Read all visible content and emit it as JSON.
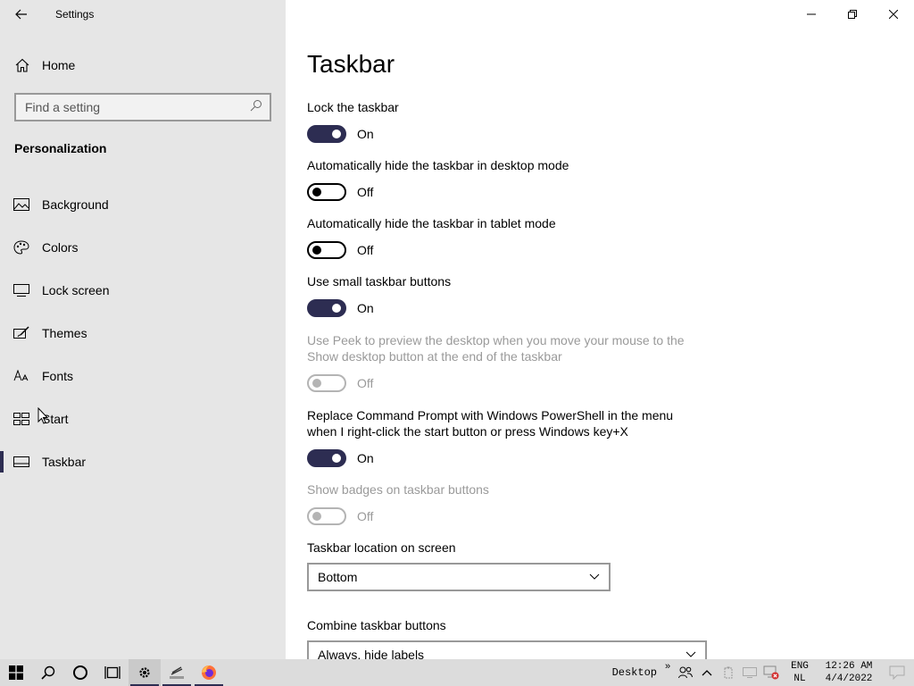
{
  "window": {
    "title": "Settings"
  },
  "sidebar": {
    "home_label": "Home",
    "search_placeholder": "Find a setting",
    "section_title": "Personalization",
    "items": [
      {
        "label": "Background",
        "icon": "image-icon"
      },
      {
        "label": "Colors",
        "icon": "palette-icon"
      },
      {
        "label": "Lock screen",
        "icon": "monitor-lock-icon"
      },
      {
        "label": "Themes",
        "icon": "brush-icon"
      },
      {
        "label": "Fonts",
        "icon": "font-icon"
      },
      {
        "label": "Start",
        "icon": "start-tiles-icon"
      },
      {
        "label": "Taskbar",
        "icon": "taskbar-icon",
        "selected": true
      }
    ]
  },
  "main": {
    "title": "Taskbar",
    "settings": [
      {
        "label": "Lock the taskbar",
        "state": "On",
        "enabled": true
      },
      {
        "label": "Automatically hide the taskbar in desktop mode",
        "state": "Off",
        "enabled": true
      },
      {
        "label": "Automatically hide the taskbar in tablet mode",
        "state": "Off",
        "enabled": true
      },
      {
        "label": "Use small taskbar buttons",
        "state": "On",
        "enabled": true
      },
      {
        "label": "Use Peek to preview the desktop when you move your mouse to the Show desktop button at the end of the taskbar",
        "state": "Off",
        "enabled": false
      },
      {
        "label": "Replace Command Prompt with Windows PowerShell in the menu when I right-click the start button or press Windows key+X",
        "state": "On",
        "enabled": true
      },
      {
        "label": "Show badges on taskbar buttons",
        "state": "Off",
        "enabled": false
      }
    ],
    "location": {
      "label": "Taskbar location on screen",
      "value": "Bottom"
    },
    "combine": {
      "label": "Combine taskbar buttons",
      "value": "Always, hide labels"
    }
  },
  "taskbar": {
    "desktop_label": "Desktop",
    "lang_top": "ENG",
    "lang_bottom": "NL",
    "time": "12:26 AM",
    "date": "4/4/2022"
  },
  "colors": {
    "accent": "#2d2d52",
    "sidebar_bg": "#e6e6e6",
    "disabled": "#9a9a9a"
  }
}
